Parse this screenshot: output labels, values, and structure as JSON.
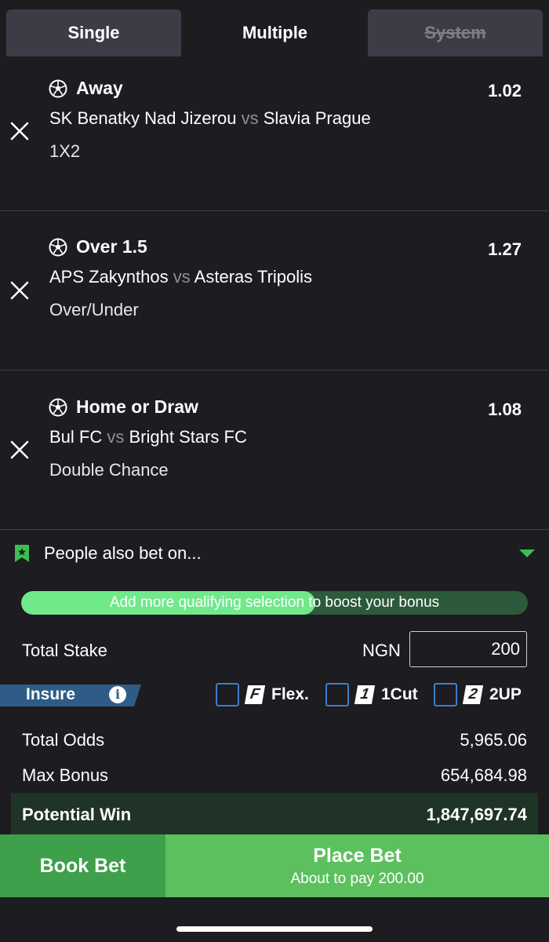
{
  "tabs": [
    {
      "label": "Single",
      "active": false
    },
    {
      "label": "Multiple",
      "active": true
    },
    {
      "label": "System",
      "disabled": true
    }
  ],
  "selections": [
    {
      "pick": "Away",
      "odds": "1.02",
      "home": "SK Benatky Nad Jizerou",
      "vs": "vs",
      "away": "Slavia Prague",
      "market": "1X2"
    },
    {
      "pick": "Over 1.5",
      "odds": "1.27",
      "home": "APS Zakynthos",
      "vs": "vs",
      "away": "Asteras Tripolis",
      "market": "Over/Under"
    },
    {
      "pick": "Home or Draw",
      "odds": "1.08",
      "home": "Bul FC",
      "vs": "vs",
      "away": "Bright Stars FC",
      "market": "Double Chance"
    }
  ],
  "also_bet": {
    "label": "People also bet on..."
  },
  "bonus": {
    "text": "Add more qualifying selection to boost your bonus",
    "progress": 0.58
  },
  "stake": {
    "label": "Total Stake",
    "currency": "NGN",
    "value": "200"
  },
  "insure": {
    "label": "Insure",
    "info_icon": "i"
  },
  "options": [
    {
      "badge": "F",
      "label": "Flex."
    },
    {
      "badge": "1",
      "label": "1Cut"
    },
    {
      "badge": "2",
      "label": "2UP"
    }
  ],
  "totals": {
    "total_odds_label": "Total Odds",
    "total_odds": "5,965.06",
    "max_bonus_label": "Max Bonus",
    "max_bonus": "654,684.98",
    "potential_win_label": "Potential Win",
    "potential_win": "1,847,697.74"
  },
  "actions": {
    "book_bet": "Book Bet",
    "place_bet": "Place Bet",
    "place_bet_sub": "About to pay 200.00"
  },
  "colors": {
    "accent_green": "#5cc05f",
    "dark_green": "#3ea04a",
    "insure_blue": "#2f5c86",
    "background": "#1c1c21"
  }
}
